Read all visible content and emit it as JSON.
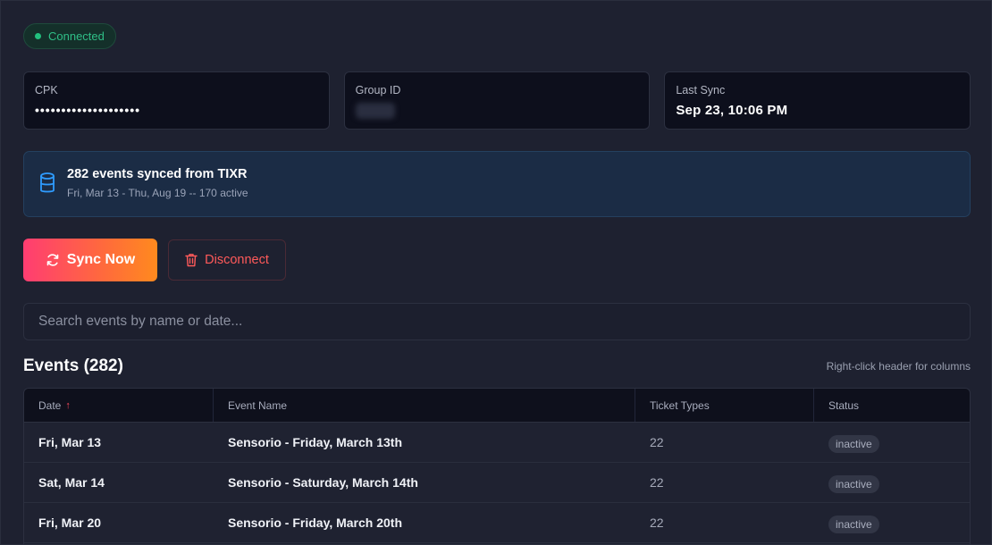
{
  "status": {
    "label": "Connected"
  },
  "cards": [
    {
      "label": "CPK",
      "value": "••••••••••••••••••••"
    },
    {
      "label": "Group ID",
      "value": ""
    },
    {
      "label": "Last Sync",
      "value": "Sep 23, 10:06 PM"
    }
  ],
  "info": {
    "title": "282 events synced from TIXR",
    "subtitle": "Fri, Mar 13 - Thu, Aug 19 -- 170 active"
  },
  "actions": {
    "sync_label": "Sync Now",
    "disconnect_label": "Disconnect"
  },
  "search": {
    "placeholder": "Search events by name or date..."
  },
  "events": {
    "title": "Events (282)",
    "hint": "Right-click header for columns",
    "columns": [
      "Date",
      "Event Name",
      "Ticket Types",
      "Status"
    ],
    "rows": [
      {
        "date": "Fri, Mar 13",
        "name": "Sensorio - Friday, March 13th",
        "ticket_types": "22",
        "status": "inactive"
      },
      {
        "date": "Sat, Mar 14",
        "name": "Sensorio - Saturday, March 14th",
        "ticket_types": "22",
        "status": "inactive"
      },
      {
        "date": "Fri, Mar 20",
        "name": "Sensorio - Friday, March 20th",
        "ticket_types": "22",
        "status": "inactive"
      }
    ]
  },
  "colors": {
    "accent_start": "#ff3d72",
    "accent_end": "#ff8a1e",
    "success": "#22c07e",
    "danger": "#ff5a5a"
  },
  "icons": {
    "info": "database-icon",
    "sync": "refresh-icon",
    "disconnect": "trash-icon",
    "sort": "arrow-up-icon"
  }
}
